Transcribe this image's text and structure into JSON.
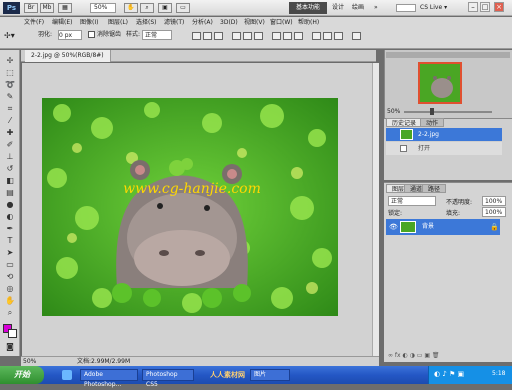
{
  "app": {
    "logo": "Ps"
  },
  "menu": [
    "文件(F)",
    "编辑(E)",
    "图像(I)",
    "图层(L)",
    "选择(S)",
    "滤镜(T)",
    "分析(A)",
    "3D(D)",
    "视图(V)",
    "窗口(W)",
    "帮助(H)"
  ],
  "toolbar_top": {
    "zoom": "50%"
  },
  "workspace": {
    "active": "基本功能",
    "links": [
      "设计",
      "绘画",
      "»"
    ]
  },
  "cs_live": "CS Live ▾",
  "options": {
    "feather_label": "羽化:",
    "feather_value": "0 px",
    "antialias": "消除锯齿",
    "style_label": "样式:",
    "style_value": "正常",
    "refine": "调整边缘..."
  },
  "document": {
    "tab": "2-2.jpg @ 50%(RGB/8#)",
    "zoom": "50%",
    "doc_size": "文档:2.99M/2.99M"
  },
  "watermark": "www.cg-hanjie.com",
  "panels": {
    "nav_tab": "导航器",
    "nav_zoom": "50%",
    "history_tabs": [
      "历史记录",
      "动作"
    ],
    "history_items": [
      "2-2.jpg",
      "打开"
    ],
    "layers_tabs": [
      "图层",
      "通道",
      "路径"
    ],
    "blend_mode": "正常",
    "opacity_label": "不透明度:",
    "opacity": "100%",
    "lock_label": "锁定:",
    "fill_label": "填充:",
    "fill": "100%",
    "layer_name": "背景"
  },
  "colors": {
    "foreground": "#d800d8",
    "background": "#ffffff",
    "selection": "#3c78d8"
  },
  "taskbar": {
    "start": "开始",
    "tasks": [
      "Adobe Photoshop...",
      "Photoshop CS5",
      "图片"
    ],
    "logo_text": "人人素材网",
    "time": "5:18"
  }
}
